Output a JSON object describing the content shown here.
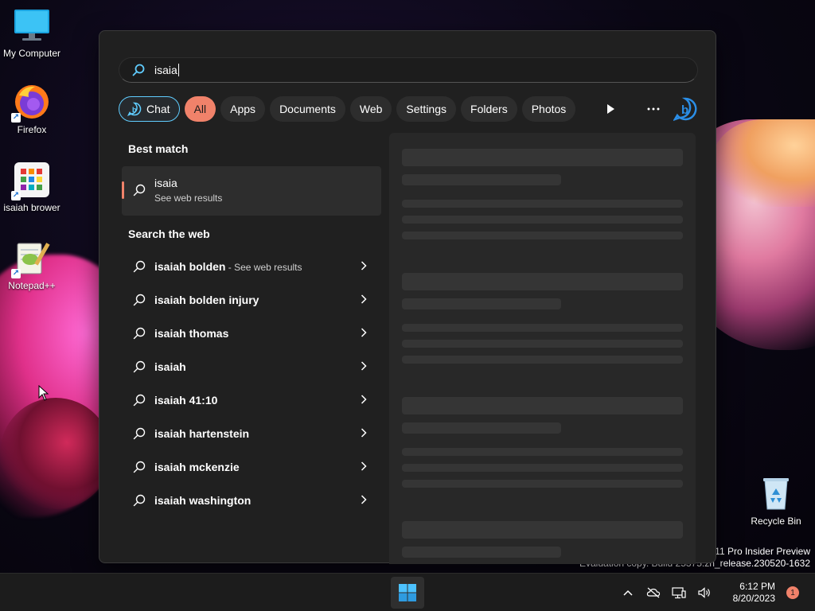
{
  "desktop": {
    "icons": [
      {
        "label": "My Computer",
        "icon": "monitor-icon"
      },
      {
        "label": "Firefox",
        "icon": "firefox-icon"
      },
      {
        "label": "isaiah brower",
        "icon": "app-grid-icon"
      },
      {
        "label": "Notepad++",
        "icon": "notepad-plus-plus-icon"
      },
      {
        "label": "Recycle Bin",
        "icon": "recycle-bin-icon"
      }
    ],
    "watermark": {
      "line1": "s 11 Pro Insider Preview",
      "line2": "Evaluation copy. Build 25375.zn_release.230520-1632"
    }
  },
  "search": {
    "query": "isaia",
    "filters": [
      {
        "label": "Chat",
        "icon": "bing-chat-icon"
      },
      {
        "label": "All",
        "selected": true
      },
      {
        "label": "Apps"
      },
      {
        "label": "Documents"
      },
      {
        "label": "Web"
      },
      {
        "label": "Settings"
      },
      {
        "label": "Folders"
      },
      {
        "label": "Photos"
      }
    ],
    "more_icons": [
      "play-icon",
      "more-icon",
      "bing-icon"
    ],
    "best_match": {
      "heading": "Best match",
      "title": "isaia",
      "subtitle": "See web results"
    },
    "web": {
      "heading": "Search the web",
      "items": [
        {
          "text": "isaiah bolden",
          "hint": " - See web results"
        },
        {
          "text": "isaiah bolden injury"
        },
        {
          "text": "isaiah thomas"
        },
        {
          "text": "isaiah"
        },
        {
          "text": "isaiah 41:10"
        },
        {
          "text": "isaiah hartenstein"
        },
        {
          "text": "isaiah mckenzie"
        },
        {
          "text": "isaiah washington"
        }
      ]
    }
  },
  "taskbar": {
    "time": "6:12 PM",
    "date": "8/20/2023",
    "notification_count": "1",
    "tray_icons": [
      "chevron-up-icon",
      "onedrive-off-icon",
      "network-icon",
      "volume-icon"
    ]
  },
  "colors": {
    "accent": "#f0826a",
    "chat_border": "#60cdff",
    "panel_bg": "#202020"
  }
}
